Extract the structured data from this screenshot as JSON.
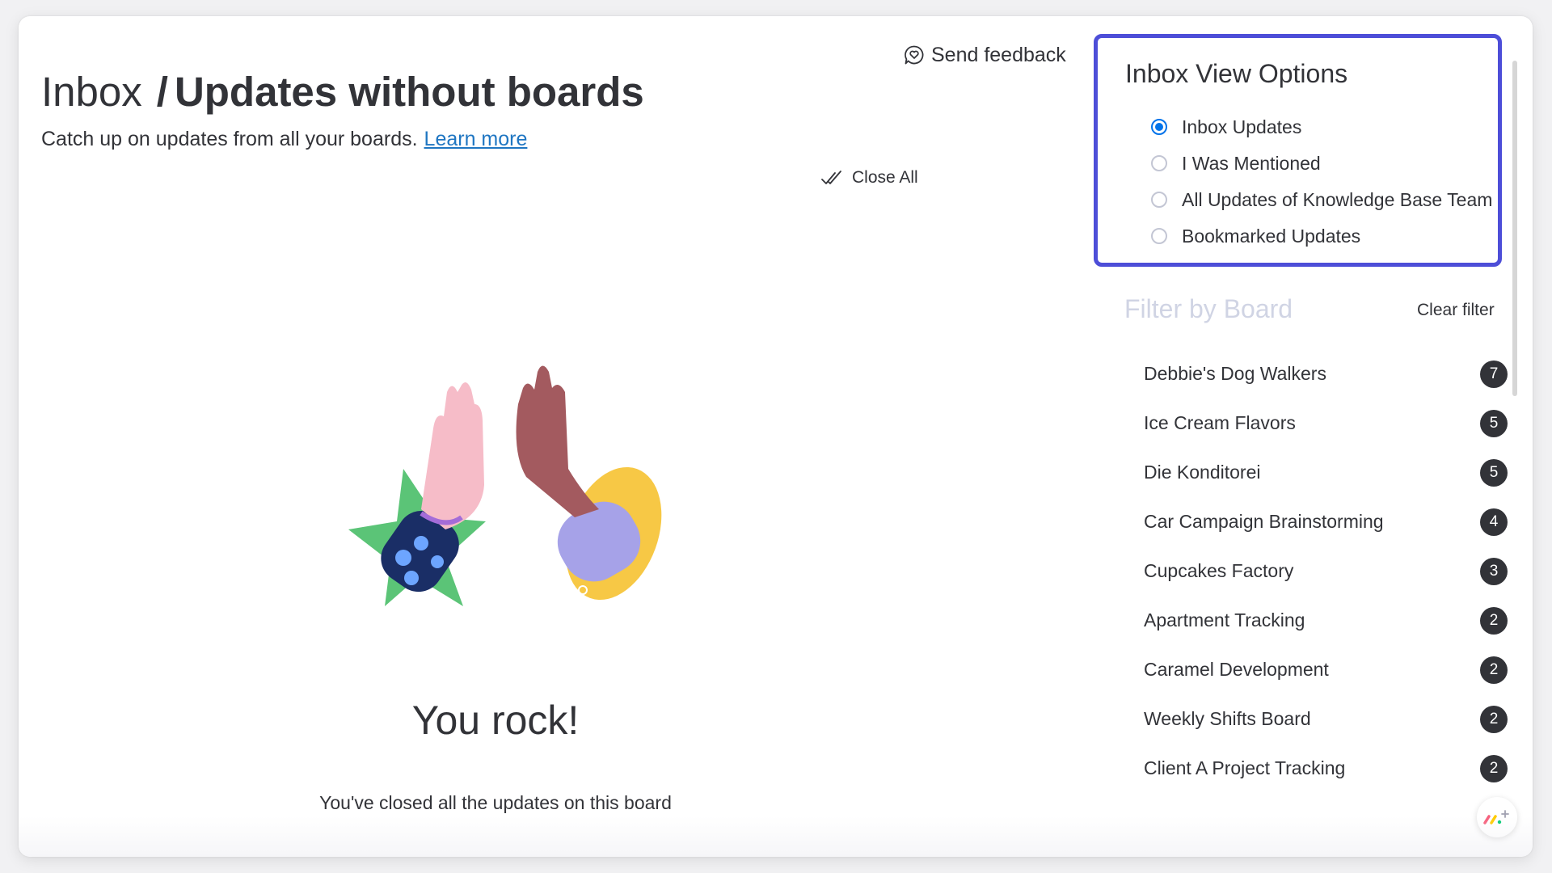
{
  "header": {
    "breadcrumb_root": "Inbox",
    "breadcrumb_separator": "/",
    "breadcrumb_current": "Updates without boards",
    "subtitle": "Catch up on updates from all your boards.",
    "learn_more": "Learn more"
  },
  "toolbar": {
    "send_feedback": "Send feedback",
    "close_all": "Close All"
  },
  "empty_state": {
    "title": "You rock!",
    "message": "You've closed all the updates on this board"
  },
  "inbox_view_options": {
    "title": "Inbox View Options",
    "selected": "Inbox Updates",
    "options": [
      {
        "label": "Inbox Updates",
        "checked": true
      },
      {
        "label": "I Was Mentioned",
        "checked": false
      },
      {
        "label": "All Updates of Knowledge Base Team",
        "checked": false
      },
      {
        "label": "Bookmarked Updates",
        "checked": false
      }
    ]
  },
  "filter_by_board": {
    "title": "Filter by Board",
    "clear_filter": "Clear filter",
    "boards": [
      {
        "name": "Debbie's Dog Walkers",
        "count": "7"
      },
      {
        "name": "Ice Cream Flavors",
        "count": "5"
      },
      {
        "name": "Die Konditorei",
        "count": "5"
      },
      {
        "name": "Car Campaign Brainstorming",
        "count": "4"
      },
      {
        "name": "Cupcakes Factory",
        "count": "3"
      },
      {
        "name": "Apartment Tracking",
        "count": "2"
      },
      {
        "name": "Caramel Development",
        "count": "2"
      },
      {
        "name": "Weekly Shifts Board",
        "count": "2"
      },
      {
        "name": "Client A Project Tracking",
        "count": "2"
      }
    ]
  },
  "icons": {
    "feedback": "heart-chat-bubble-icon",
    "close_all": "double-check-icon",
    "help": "monday-logo-plus-icon"
  },
  "colors": {
    "accent_border": "#4d4ed8",
    "radio_selected": "#0073ea",
    "link": "#1f76c2",
    "badge_bg": "#323338"
  }
}
